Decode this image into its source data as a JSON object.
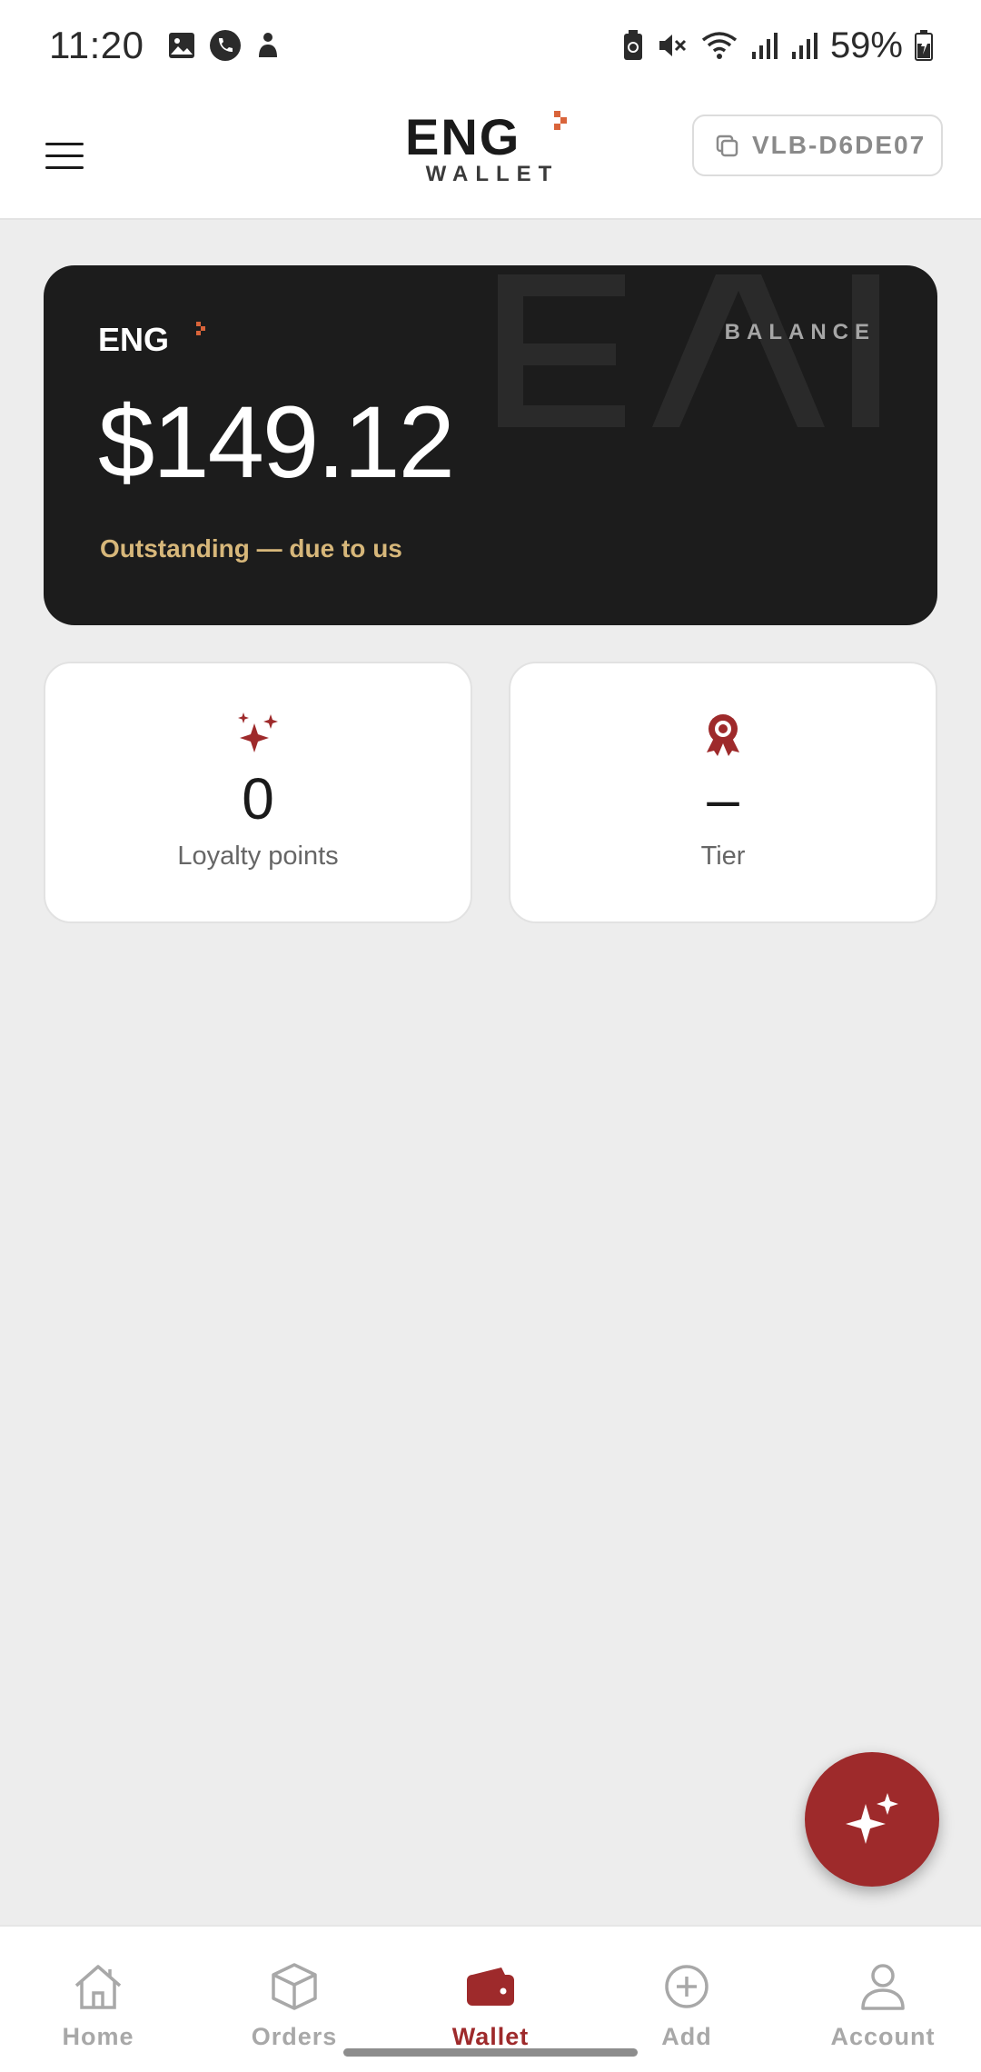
{
  "status_bar": {
    "time": "11:20",
    "battery": "59%",
    "left_icons": [
      "gallery-icon",
      "phone-icon",
      "notification-icon"
    ],
    "right_icons": [
      "battery-saver-icon",
      "mute-icon",
      "wifi-icon",
      "signal-icon",
      "signal-icon",
      "battery-icon"
    ]
  },
  "header": {
    "brand": "ENG",
    "brand_sub": "WALLET",
    "account_id": "VLB-D6DE07",
    "menu_icon": "menu-icon",
    "copy_icon": "copy-icon"
  },
  "balance_card": {
    "brand": "ENG",
    "label": "BALANCE",
    "amount": "$149.12",
    "note": "Outstanding — due to us"
  },
  "stats": [
    {
      "icon": "sparkles-icon",
      "value": "0",
      "label": "Loyalty points"
    },
    {
      "icon": "award-icon",
      "value": "–",
      "label": "Tier"
    }
  ],
  "fab": {
    "icon": "sparkles-icon"
  },
  "bottom_nav": [
    {
      "label": "Home",
      "icon": "home-icon",
      "active": false
    },
    {
      "label": "Orders",
      "icon": "box-icon",
      "active": false
    },
    {
      "label": "Wallet",
      "icon": "wallet-icon",
      "active": true
    },
    {
      "label": "Add",
      "icon": "plus-circle-icon",
      "active": false
    },
    {
      "label": "Account",
      "icon": "user-icon",
      "active": false
    }
  ],
  "colors": {
    "accent": "#9e2a2b",
    "card_bg": "#1c1c1c",
    "note_gold": "#d7b77a",
    "page_bg": "#ededed"
  }
}
